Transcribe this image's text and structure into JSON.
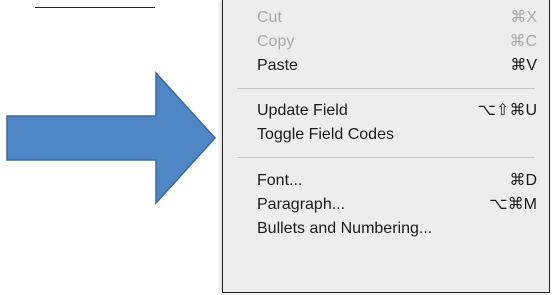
{
  "context_menu": {
    "groups": [
      [
        {
          "label": "Cut",
          "shortcut": "⌘X",
          "enabled": false
        },
        {
          "label": "Copy",
          "shortcut": "⌘C",
          "enabled": false
        },
        {
          "label": "Paste",
          "shortcut": "⌘V",
          "enabled": true
        }
      ],
      [
        {
          "label": "Update Field",
          "shortcut": "⌥⇧⌘U",
          "enabled": true
        },
        {
          "label": "Toggle Field Codes",
          "shortcut": "",
          "enabled": true
        }
      ],
      [
        {
          "label": "Font...",
          "shortcut": "⌘D",
          "enabled": true
        },
        {
          "label": "Paragraph...",
          "shortcut": "⌥⌘M",
          "enabled": true
        },
        {
          "label": "Bullets and Numbering...",
          "shortcut": "",
          "enabled": true
        }
      ]
    ]
  },
  "annotation": {
    "arrow_color": "#4f86c6",
    "arrow_border": "#3b6a9e",
    "arrow_icon": "right-arrow-icon"
  }
}
